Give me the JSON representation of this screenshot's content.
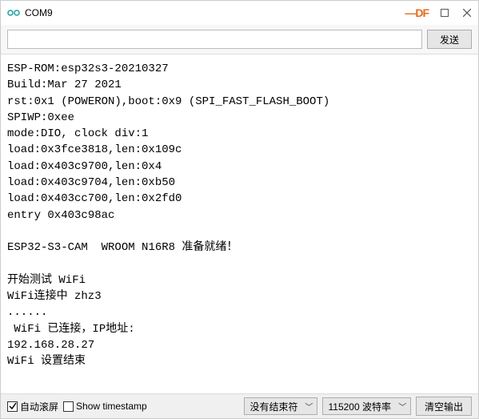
{
  "window": {
    "title": "COM9",
    "df_label": "DF"
  },
  "send": {
    "input_value": "",
    "button_label": "发送"
  },
  "output": {
    "lines": [
      "ESP-ROM:esp32s3-20210327",
      "Build:Mar 27 2021",
      "rst:0x1 (POWERON),boot:0x9 (SPI_FAST_FLASH_BOOT)",
      "SPIWP:0xee",
      "mode:DIO, clock div:1",
      "load:0x3fce3818,len:0x109c",
      "load:0x403c9700,len:0x4",
      "load:0x403c9704,len:0xb50",
      "load:0x403cc700,len:0x2fd0",
      "entry 0x403c98ac",
      "",
      "ESP32-S3-CAM  WROOM N16R8 准备就绪！",
      "",
      "开始测试 WiFi",
      "WiFi连接中 zhz3",
      "......",
      " WiFi 已连接，IP地址:",
      "192.168.28.27",
      "WiFi 设置结束",
      ""
    ]
  },
  "bottom": {
    "autoscroll": {
      "label": "自动滚屏",
      "checked": true
    },
    "timestamp": {
      "label": "Show timestamp",
      "checked": false
    },
    "line_ending": {
      "selected": "没有结束符"
    },
    "baud": {
      "selected": "115200 波特率"
    },
    "clear_button_label": "清空输出"
  }
}
